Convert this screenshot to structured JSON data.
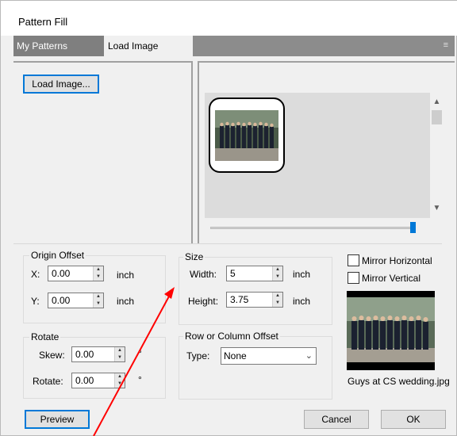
{
  "dialog": {
    "title": "Pattern Fill"
  },
  "tabs": [
    {
      "label": "My Patterns",
      "active": false
    },
    {
      "label": "Load Image",
      "active": true
    }
  ],
  "tab_menu_icon": "≡",
  "buttons": {
    "load_image": "Load Image...",
    "preview": "Preview",
    "cancel": "Cancel",
    "ok": "OK"
  },
  "origin_offset": {
    "label": "Origin Offset",
    "x_label": "X:",
    "x_value": "0.00",
    "y_label": "Y:",
    "y_value": "0.00",
    "unit": "inch"
  },
  "size": {
    "label": "Size",
    "width_label": "Width:",
    "width_value": "5",
    "height_label": "Height:",
    "height_value": "3.75",
    "unit": "inch"
  },
  "rotate": {
    "label": "Rotate",
    "skew_label": "Skew:",
    "skew_value": "0.00",
    "rotate_label": "Rotate:",
    "rotate_value": "0.00",
    "unit": "°"
  },
  "row_column_offset": {
    "label": "Row or Column Offset",
    "type_label": "Type:",
    "type_value": "None"
  },
  "mirror": {
    "horizontal": "Mirror Horizontal",
    "vertical": "Mirror Vertical"
  },
  "image": {
    "filename": "Guys at CS wedding.jpg"
  },
  "icons": {
    "scroll_up": "chevron-up-icon",
    "scroll_down": "chevron-down-icon",
    "dropdown": "chevron-down-icon",
    "annotation": "red-arrow-annotation"
  },
  "colors": {
    "accent": "#0078d7",
    "dialog_bg": "#f0f0f0",
    "annotation": "#ff0000"
  }
}
